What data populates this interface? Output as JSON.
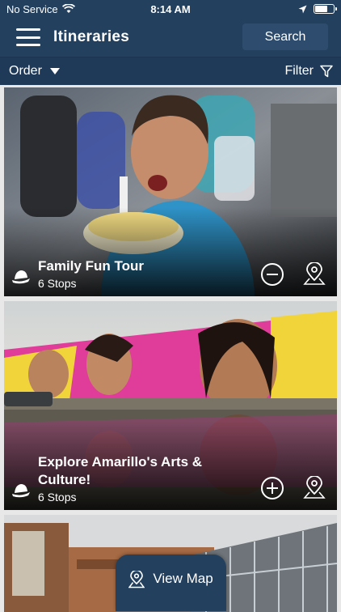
{
  "status_bar": {
    "carrier": "No Service",
    "time": "8:14 AM",
    "battery_level": 0.7
  },
  "header": {
    "title": "Itineraries",
    "search_label": "Search"
  },
  "toolbar": {
    "order_label": "Order",
    "filter_label": "Filter"
  },
  "itineraries": [
    {
      "name": "Family Fun Tour",
      "stops": "6 Stops",
      "action": "remove"
    },
    {
      "name": "Explore Amarillo's Arts & Culture!",
      "stops": "6 Stops",
      "action": "add"
    }
  ],
  "footer": {
    "view_map_label": "View Map"
  },
  "icons": {
    "menu": "hamburger-icon",
    "filter": "filter-icon",
    "category": "hat-icon",
    "pin": "map-pin-icon"
  },
  "colors": {
    "header_bg": "#23405f",
    "subbar_bg": "#1f3a58",
    "text": "#ffffff"
  }
}
